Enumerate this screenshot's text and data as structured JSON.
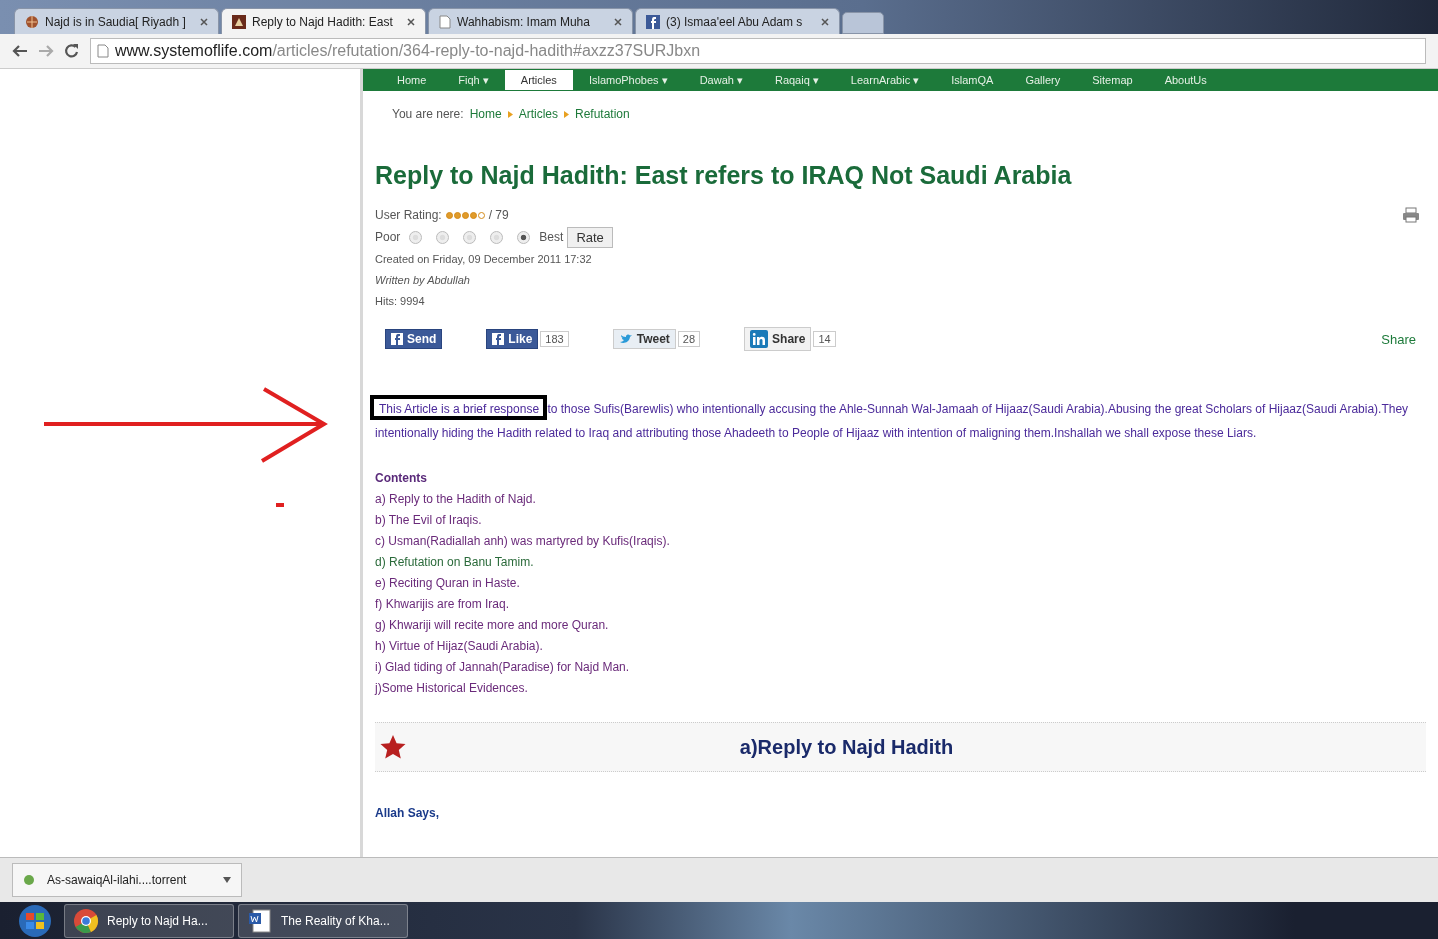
{
  "browser": {
    "tabs": [
      {
        "title": "Najd is in Saudia[ Riyadh ]",
        "selected": false,
        "kind": "globe"
      },
      {
        "title": "Reply to Najd Hadith: East",
        "selected": true,
        "kind": "site"
      },
      {
        "title": "Wahhabism: Imam Muha",
        "selected": false,
        "kind": "page"
      },
      {
        "title": "(3) Ismaa'eel Abu Adam s",
        "selected": false,
        "kind": "facebook"
      }
    ],
    "url_host": "www.systemoflife.com",
    "url_path": "/articles/refutation/364-reply-to-najd-hadith#axzz37SURJbxn"
  },
  "nav": [
    {
      "label": "Home",
      "selected": false
    },
    {
      "label": "Fiqh ▾",
      "selected": false
    },
    {
      "label": "Articles",
      "selected": true
    },
    {
      "label": "IslamoPhobes ▾",
      "selected": false
    },
    {
      "label": "Dawah ▾",
      "selected": false
    },
    {
      "label": "Raqaiq ▾",
      "selected": false
    },
    {
      "label": "LearnArabic ▾",
      "selected": false
    },
    {
      "label": "IslamQA",
      "selected": false
    },
    {
      "label": "Gallery",
      "selected": false
    },
    {
      "label": "Sitemap",
      "selected": false
    },
    {
      "label": "AboutUs",
      "selected": false
    }
  ],
  "breadcrumb": {
    "prefix": "You are nere:",
    "items": [
      "Home",
      "Articles",
      "Refutation"
    ]
  },
  "article": {
    "title": "Reply to Najd Hadith: East refers to IRAQ Not Saudi Arabia",
    "rating_label": "User Rating:",
    "stars": 4,
    "rating_count": "/ 79",
    "vote_low": "Poor",
    "vote_high": "Best",
    "votes": [
      {
        "selected": false
      },
      {
        "selected": false
      },
      {
        "selected": false
      },
      {
        "selected": false
      },
      {
        "selected": true
      }
    ],
    "rate_button": "Rate",
    "created": "Created on Friday, 09 December 2011 17:32",
    "author": "Written by Abdullah",
    "hits": "Hits: 9994"
  },
  "social": [
    {
      "kind": "facebook",
      "label": "Send"
    },
    {
      "kind": "facebook",
      "label": "Like",
      "count": "183"
    },
    {
      "kind": "twitter",
      "label": "Tweet",
      "count": "28"
    },
    {
      "kind": "linkedin",
      "label": "Share",
      "count": "14"
    }
  ],
  "share_link": "Share",
  "intro_highlight": "This Article is a brief response",
  "intro_rest": " to those Sufis(Barewlis) who intentionally accusing the Ahle-Sunnah Wal-Jamaah of Hijaaz(Saudi Arabia).Abusing the great Scholars of Hijaaz(Saudi Arabia).They intentionally hiding the Hadith related to Iraq and attributing those Ahadeeth to People of Hijaaz with intention of maligning them.Inshallah we shall expose these Liars.",
  "contents": {
    "heading": "Contents",
    "items": [
      {
        "text": "a) Reply to the Hadith of Najd.",
        "visited": true
      },
      {
        "text": "b) The Evil of Iraqis.",
        "visited": true
      },
      {
        "text": "c) Usman(Radiallah anh) was martyred by Kufis(Iraqis).",
        "visited": true
      },
      {
        "text": "d) Refutation on Banu Tamim.",
        "visited": false
      },
      {
        "text": "e) Reciting Quran in Haste.",
        "visited": true
      },
      {
        "text": "f) Khwarijis are from Iraq.",
        "visited": true
      },
      {
        "text": "g) Khwariji will recite more and more Quran.",
        "visited": true
      },
      {
        "text": "h) Virtue of Hijaz(Saudi Arabia).",
        "visited": true
      },
      {
        "text": "i) Glad tiding of Jannah(Paradise) for Najd Man.",
        "visited": true
      },
      {
        "text": "j)Some  Historical Evidences.",
        "visited": true
      }
    ]
  },
  "section_heading": "a)Reply to Najd Hadith",
  "section_intro": "Allah Says,",
  "download": {
    "file": "As-sawaiqAl-ilahi....torrent"
  },
  "taskbar": [
    {
      "kind": "chrome",
      "label": "Reply to Najd Ha..."
    },
    {
      "kind": "word",
      "label": "The Reality of Kha..."
    }
  ]
}
